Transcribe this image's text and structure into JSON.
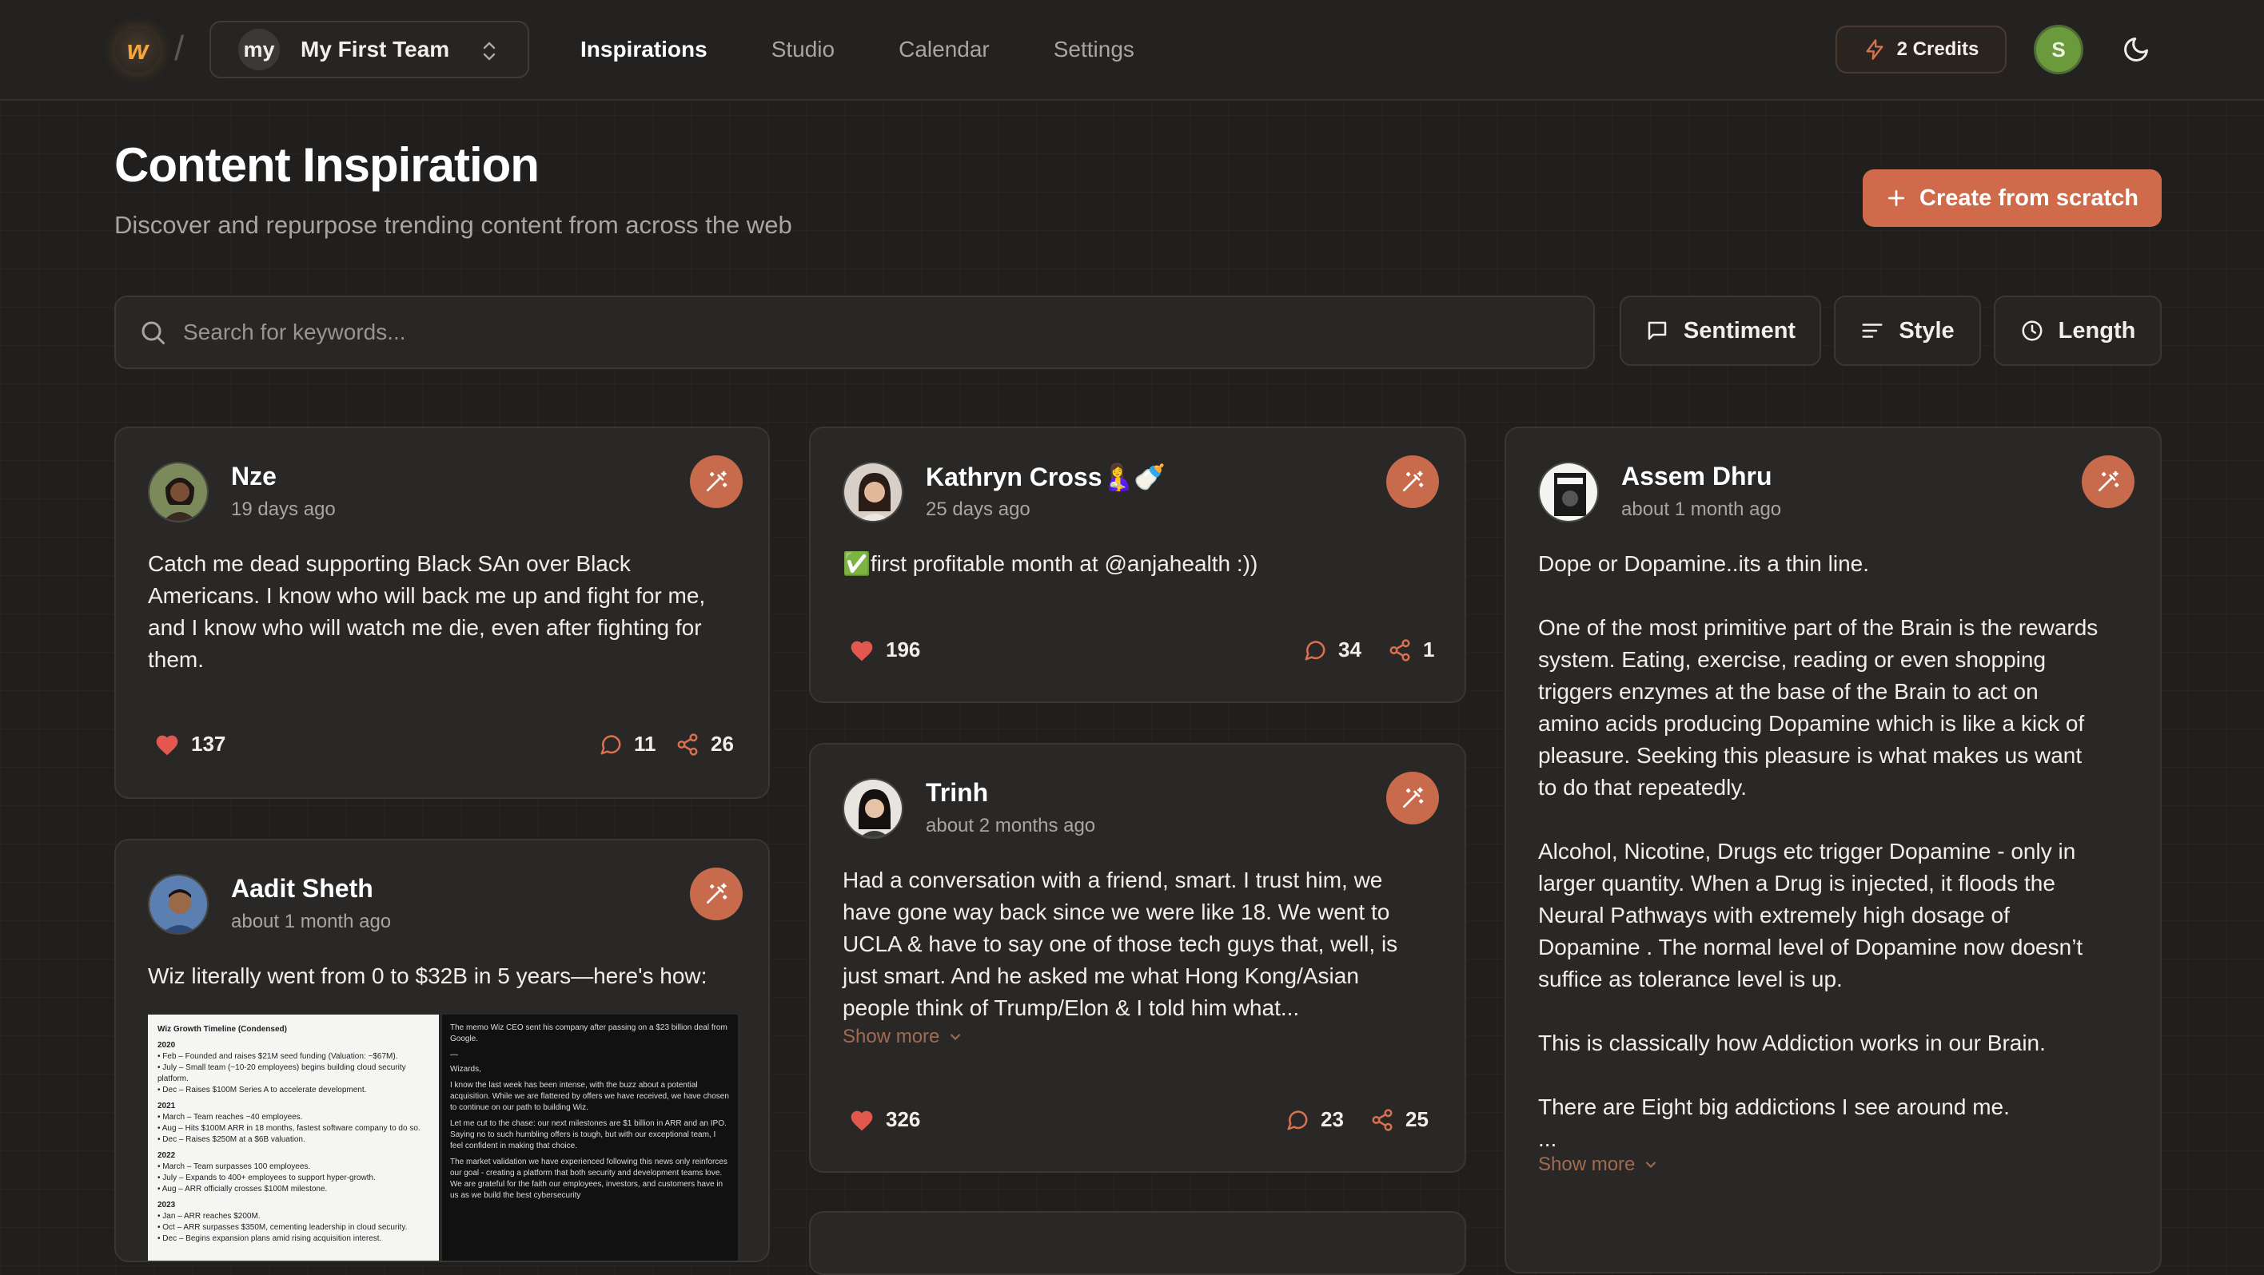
{
  "header": {
    "logo_letter": "w",
    "team": {
      "badge": "my",
      "name": "My First Team"
    },
    "nav": [
      {
        "label": "Inspirations",
        "active": true
      },
      {
        "label": "Studio",
        "active": false
      },
      {
        "label": "Calendar",
        "active": false
      },
      {
        "label": "Settings",
        "active": false
      }
    ],
    "credits_label": "2 Credits",
    "user_initial": "S"
  },
  "page": {
    "title": "Content Inspiration",
    "subtitle": "Discover and repurpose trending content from across the web",
    "create_label": "Create from scratch",
    "search_placeholder": "Search for keywords...",
    "filters": {
      "sentiment": "Sentiment",
      "style": "Style",
      "length": "Length"
    }
  },
  "posts": {
    "nze": {
      "name": "Nze",
      "time": "19 days ago",
      "body": "Catch me dead supporting Black SAn over Black\nAmericans. I know who will back me up and fight for me,\nand I know who will watch me die, even after fighting for\nthem.",
      "likes": "137",
      "comments": "11",
      "shares": "26"
    },
    "aadit": {
      "name": "Aadit Sheth",
      "time": "about 1 month ago",
      "body": "Wiz literally went from 0 to $32B in 5 years—here's how:",
      "thumb_left": {
        "title": "Wiz Growth Timeline (Condensed)",
        "lines": [
          "2020",
          "• Feb – Founded and raises $21M seed funding (Valuation: ~$67M).",
          "• July – Small team (~10-20 employees) begins building cloud security platform.",
          "• Dec – Raises $100M Series A to accelerate development.",
          "2021",
          "• March – Team reaches ~40 employees.",
          "• Aug – Hits $100M ARR in 18 months, fastest software company to do so.",
          "• Dec – Raises $250M at a $6B valuation.",
          "2022",
          "• March – Team surpasses 100 employees.",
          "• July – Expands to 400+ employees to support hyper-growth.",
          "• Aug – ARR officially crosses $100M milestone.",
          "2023",
          "• Jan – ARR reaches $200M.",
          "• Oct – ARR surpasses $350M, cementing leadership in cloud security.",
          "• Dec – Begins expansion plans amid rising acquisition interest."
        ]
      },
      "thumb_right": {
        "lines": [
          "The memo Wiz CEO sent his company after passing on a $23 billion deal from Google.",
          "—",
          "Wizards,",
          "I know the last week has been intense, with the buzz about a potential acquisition. While we are flattered by offers we have received, we have chosen to continue on our path to building Wiz.",
          "Let me cut to the chase: our next milestones are $1 billion in ARR and an IPO. Saying no to such humbling offers is tough, but with our exceptional team, I feel confident in making that choice.",
          "The market validation we have experienced following this news only reinforces our goal - creating a platform that both security and development teams love. We are grateful for the faith our employees, investors, and customers have in us as we build the best cybersecurity"
        ]
      }
    },
    "kathryn": {
      "name": "Kathryn Cross🤱🍼",
      "time": "25 days ago",
      "body": "✅first profitable month at @anjahealth :))",
      "likes": "196",
      "comments": "34",
      "shares": "1"
    },
    "trinh": {
      "name": "Trinh",
      "time": "about 2 months ago",
      "body": "Had a conversation with a friend, smart. I trust him, we\nhave gone way back since we were like 18. We went to\nUCLA & have to say one of those tech guys that, well, is\njust smart. And he asked me what Hong Kong/Asian\npeople think of Trump/Elon & I told him what...",
      "show_more": "Show more",
      "likes": "326",
      "comments": "23",
      "shares": "25"
    },
    "assem": {
      "name": "Assem Dhru",
      "time": "about 1 month ago",
      "body": "Dope or Dopamine..its a thin line.\n\nOne of the most primitive part of the Brain is the rewards\nsystem. Eating, exercise, reading or even shopping\ntriggers enzymes at the base of the Brain to act on\namino acids producing Dopamine which is like a kick of\npleasure. Seeking this pleasure is what makes us want\nto do that repeatedly.\n\nAlcohol, Nicotine, Drugs etc trigger Dopamine - only in\nlarger quantity. When a Drug is injected, it floods the\nNeural Pathways with extremely high dosage of\nDopamine . The normal level of Dopamine now doesn’t\nsuffice as tolerance level is up.\n\nThis is classically how Addiction works in our Brain.\n\nThere are Eight big addictions I see around me.\n...",
      "show_more": "Show more"
    }
  },
  "colors": {
    "accent": "#cf6a4a",
    "heart": "#e2584f",
    "background": "#201f1d",
    "card": "#2a2826"
  }
}
